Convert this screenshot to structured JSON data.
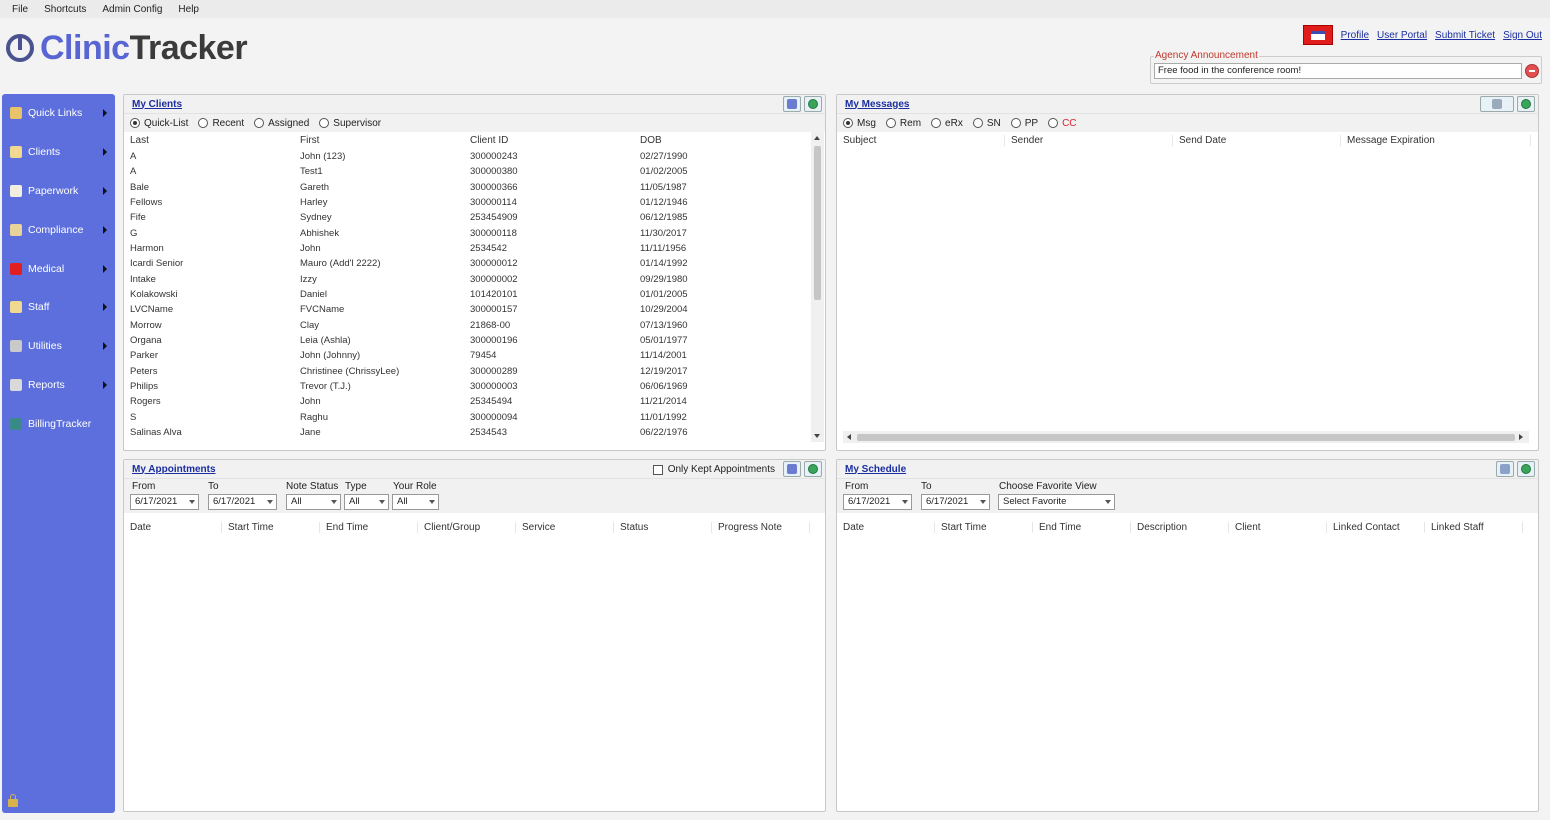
{
  "menu": [
    "File",
    "Shortcuts",
    "Admin Config",
    "Help"
  ],
  "brand": {
    "clinic": "Clinic",
    "tracker": "Tracker"
  },
  "toplinks": [
    "Profile",
    "User Portal",
    "Submit Ticket",
    "Sign Out"
  ],
  "announcement": {
    "label": "Agency Announcement",
    "text": "Free food in the conference room!"
  },
  "sidebar": {
    "items": [
      {
        "label": "Quick Links",
        "icon": "folder-icon",
        "color": "#e8c36a"
      },
      {
        "label": "Clients",
        "icon": "person-icon",
        "color": "#f0d890"
      },
      {
        "label": "Paperwork",
        "icon": "note-icon",
        "color": "#f3efe0"
      },
      {
        "label": "Compliance",
        "icon": "hourglass-icon",
        "color": "#e8d39a"
      },
      {
        "label": "Medical",
        "icon": "medical-cross-icon",
        "color": "#e02020"
      },
      {
        "label": "Staff",
        "icon": "staff-icon",
        "color": "#f0d890"
      },
      {
        "label": "Utilities",
        "icon": "gear-icon",
        "color": "#c9c9c9"
      },
      {
        "label": "Reports",
        "icon": "clipboard-icon",
        "color": "#d9d9d9"
      },
      {
        "label": "BillingTracker",
        "icon": "billing-icon",
        "color": "#3a8a8a"
      }
    ]
  },
  "clients": {
    "title": "My Clients",
    "filters": [
      "Quick-List",
      "Recent",
      "Assigned",
      "Supervisor"
    ],
    "columns": [
      "Last",
      "First",
      "Client ID",
      "DOB"
    ],
    "rows": [
      [
        "A",
        "John  (123)",
        "300000243",
        "02/27/1990"
      ],
      [
        "A",
        "Test1",
        "300000380",
        "01/02/2005"
      ],
      [
        "Bale",
        "Gareth",
        "300000366",
        "11/05/1987"
      ],
      [
        "Fellows",
        "Harley",
        "300000114",
        "01/12/1946"
      ],
      [
        "Fife",
        "Sydney",
        "253454909",
        "06/12/1985"
      ],
      [
        "G",
        "Abhishek",
        "300000118",
        "11/30/2017"
      ],
      [
        "Harmon",
        "John",
        "2534542",
        "11/11/1956"
      ],
      [
        "Icardi Senior",
        "Mauro  (Add'l 2222)",
        "300000012",
        "01/14/1992"
      ],
      [
        "Intake",
        "Izzy",
        "300000002",
        "09/29/1980"
      ],
      [
        "Kolakowski",
        "Daniel",
        "101420101",
        "01/01/2005"
      ],
      [
        "LVCName",
        "FVCName",
        "300000157",
        "10/29/2004"
      ],
      [
        "Morrow",
        "Clay",
        "21868-00",
        "07/13/1960"
      ],
      [
        "Organa",
        "Leia  (Ashla)",
        "300000196",
        "05/01/1977"
      ],
      [
        "Parker",
        "John  (Johnny)",
        "79454",
        "11/14/2001"
      ],
      [
        "Peters",
        "Christinee  (ChrissyLee)",
        "300000289",
        "12/19/2017"
      ],
      [
        "Philips",
        "Trevor  (T.J.)",
        "300000003",
        "06/06/1969"
      ],
      [
        "Rogers",
        "John",
        "25345494",
        "11/21/2014"
      ],
      [
        "S",
        "Raghu",
        "300000094",
        "11/01/1992"
      ],
      [
        "Salinas Alva",
        "Jane",
        "2534543",
        "06/22/1976"
      ]
    ]
  },
  "messages": {
    "title": "My Messages",
    "filters": [
      "Msg",
      "Rem",
      "eRx",
      "SN",
      "PP",
      "CC"
    ],
    "columns": [
      "Subject",
      "Sender",
      "Send Date",
      "Message Expiration"
    ]
  },
  "appointments": {
    "title": "My Appointments",
    "only_kept": "Only Kept Appointments",
    "from_label": "From",
    "from_value": "6/17/2021",
    "to_label": "To",
    "to_value": "6/17/2021",
    "note_status_label": "Note Status",
    "note_status_value": "All",
    "type_label": "Type",
    "type_value": "All",
    "role_label": "Your Role",
    "role_value": "All",
    "columns": [
      "Date",
      "Start Time",
      "End Time",
      "Client/Group",
      "Service",
      "Status",
      "Progress Note"
    ]
  },
  "schedule": {
    "title": "My Schedule",
    "from_label": "From",
    "from_value": "6/17/2021",
    "to_label": "To",
    "to_value": "6/17/2021",
    "fav_label": "Choose Favorite View",
    "fav_value": "Select Favorite",
    "columns": [
      "Date",
      "Start Time",
      "End Time",
      "Description",
      "Client",
      "Linked Contact",
      "Linked Staff"
    ]
  }
}
